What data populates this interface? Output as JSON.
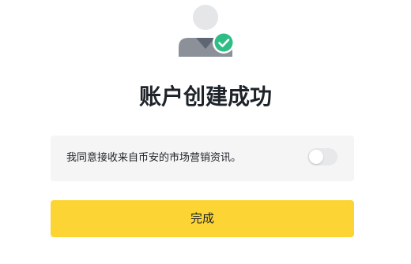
{
  "title": "账户创建成功",
  "consent": {
    "text": "我同意接收来自币安的市场营销资讯。",
    "toggle_on": false
  },
  "done_button": {
    "label": "完成"
  },
  "icons": {
    "avatar": "user-avatar-icon",
    "success": "check-circle-icon"
  },
  "colors": {
    "primary_button": "#fcd535",
    "success_green": "#2ebd85",
    "card_background": "#f5f5f5",
    "title_text": "#1e2329"
  }
}
